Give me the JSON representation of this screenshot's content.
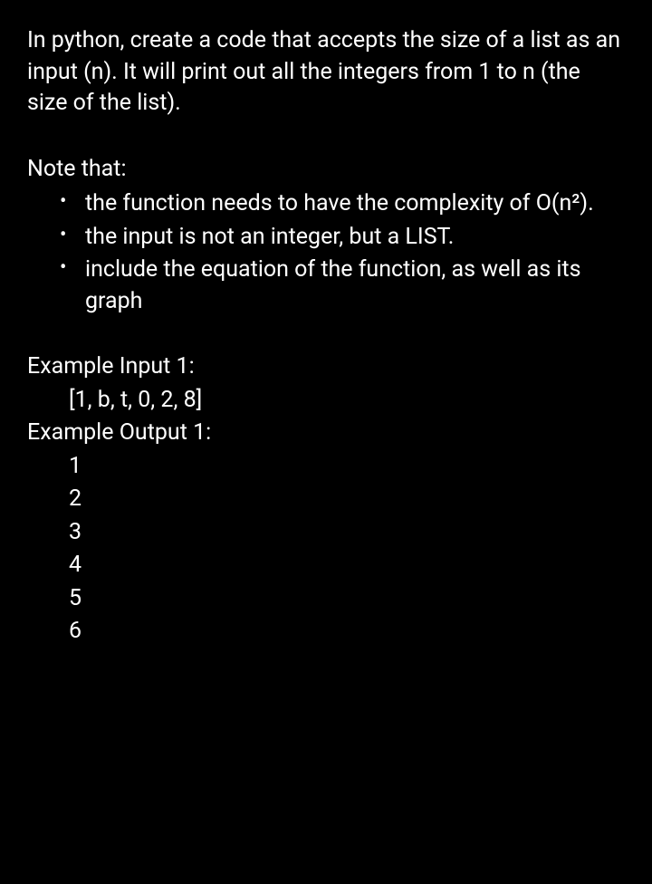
{
  "intro": "In python, create a code that accepts the size of a list as an input (n). It will print out all the integers from 1 to n (the size of the list).",
  "note_heading": "Note that:",
  "bullets": [
    "the function needs to have the complexity of O(n²).",
    "the input is not an integer, but a LIST.",
    "include the equation of the function, as well as its graph"
  ],
  "example_input_label": "Example Input 1:",
  "example_input_value": "[1, b, t, 0, 2, 8]",
  "example_output_label": "Example Output 1:",
  "example_output_lines": [
    "1",
    "2",
    "3",
    "4",
    "5",
    "6"
  ]
}
